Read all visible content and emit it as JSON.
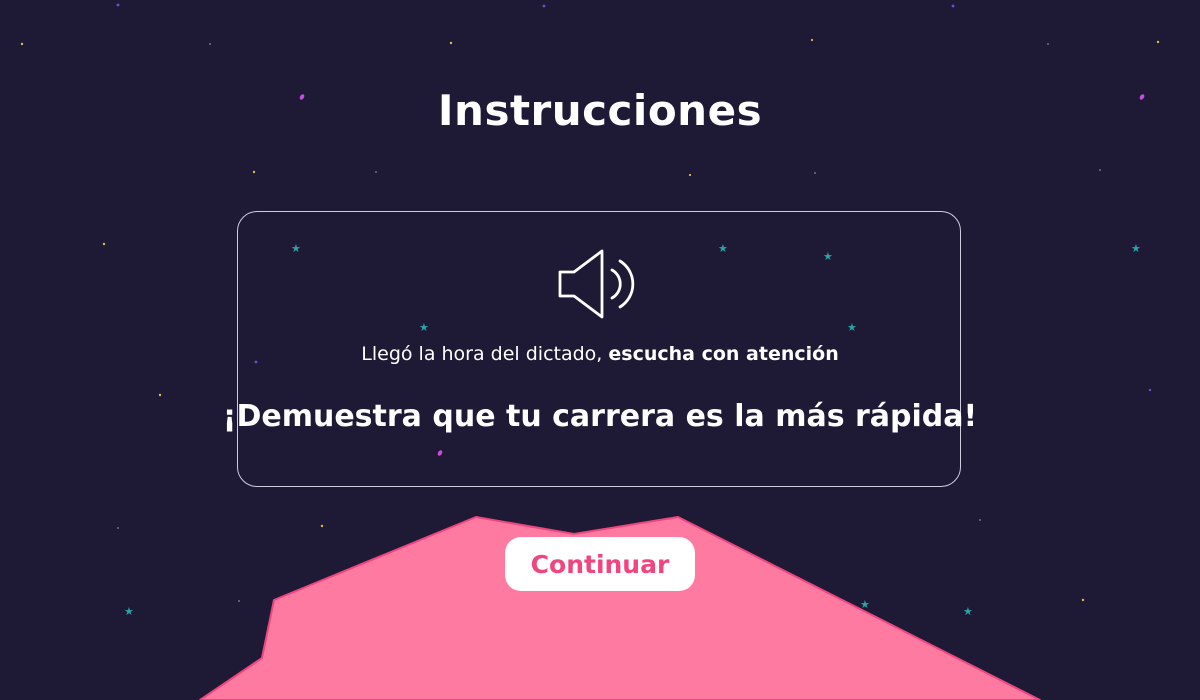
{
  "page": {
    "title": "Instrucciones"
  },
  "card": {
    "icon": "speaker-volume-icon",
    "subtitle_normal": "Llegó la hora del dictado, ",
    "subtitle_bold": "escucha con atención",
    "headline": "¡Demuestra que tu carrera es la más rápida!"
  },
  "actions": {
    "continue_label": "Continuar"
  },
  "colors": {
    "background": "#1e1a35",
    "mountain": "#ff7aa0",
    "mountain_outline": "#f0457f",
    "button_background": "#ffffff",
    "button_text": "#f0457f",
    "text": "#ffffff"
  }
}
